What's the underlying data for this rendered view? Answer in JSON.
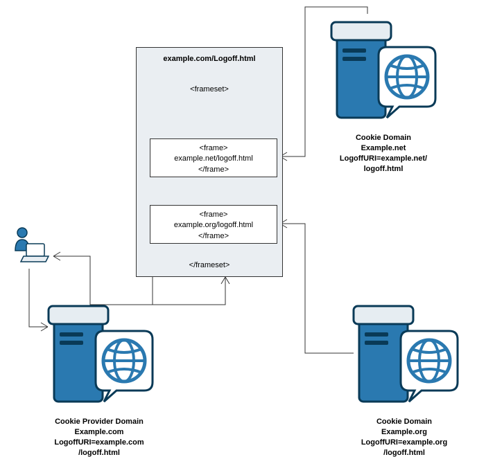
{
  "mainBox": {
    "title": "example.com/Logoff.html",
    "framesetOpen": "<frameset>",
    "framesetClose": "</frameset>",
    "frame1Line1": "<frame>",
    "frame1Line2": "example.net/logoff.html",
    "frame1Line3": "</frame>",
    "frame2Line1": "<frame>",
    "frame2Line2": "example.org/logoff.html",
    "frame2Line3": "</frame>"
  },
  "serverTopRight": {
    "line1": "Cookie Domain",
    "line2": "Example.net",
    "line3": "LogoffURI=example.net/",
    "line4": "logoff.html"
  },
  "serverBottomLeft": {
    "line1": "Cookie Provider Domain",
    "line2": "Example.com",
    "line3": "LogoffURI=example.com",
    "line4": "/logoff.html"
  },
  "serverBottomRight": {
    "line1": "Cookie Domain",
    "line2": "Example.org",
    "line3": "LogoffURI=example.org",
    "line4": "/logoff.html"
  }
}
